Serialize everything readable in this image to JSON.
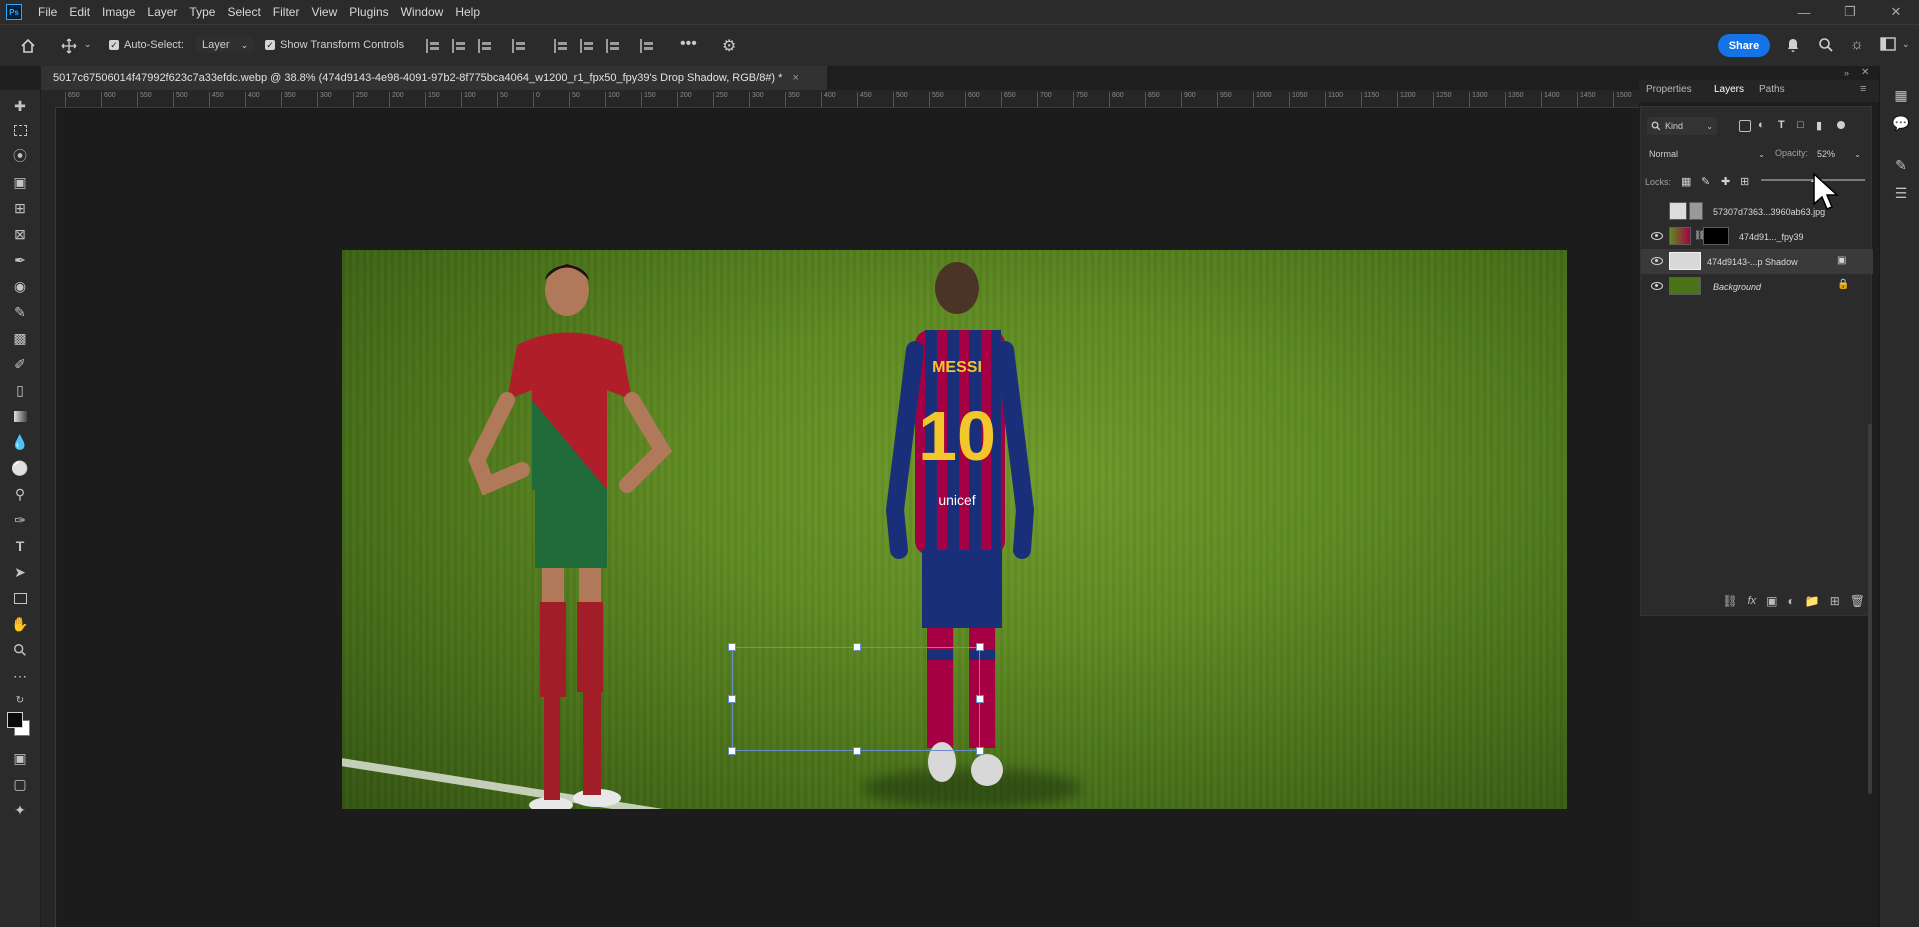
{
  "menubar": {
    "logo": "Ps",
    "items": [
      "File",
      "Edit",
      "Image",
      "Layer",
      "Type",
      "Select",
      "Filter",
      "View",
      "Plugins",
      "Window",
      "Help"
    ]
  },
  "options": {
    "auto_select_label": "Auto-Select:",
    "auto_select_target": "Layer",
    "transform_label": "Show Transform Controls",
    "share_label": "Share"
  },
  "document": {
    "tab_title": "5017c67506014f47992f623c7a33efdc.webp @ 38.8% (474d9143-4e98-4091-97b2-8f775bca4064_w1200_r1_fpx50_fpy39's Drop Shadow, RGB/8#) *",
    "close": "×"
  },
  "ruler": {
    "h_ticks": [
      "650",
      "600",
      "550",
      "500",
      "450",
      "400",
      "350",
      "300",
      "250",
      "200",
      "150",
      "100",
      "50",
      "0",
      "50",
      "100",
      "150",
      "200",
      "250",
      "300",
      "350",
      "400",
      "450",
      "500",
      "550",
      "600",
      "650",
      "700",
      "750",
      "800",
      "850",
      "900",
      "950",
      "1000",
      "1050",
      "1100",
      "1150",
      "1200",
      "1250",
      "1300",
      "1350",
      "1400",
      "1450",
      "1500"
    ]
  },
  "panel": {
    "tabs": [
      "Properties",
      "Layers",
      "Paths"
    ],
    "active_tab": "Layers",
    "filter_label": "Kind",
    "blend_mode": "Normal",
    "opacity_label": "Opacity:",
    "opacity_value": "52%",
    "locks_label": "Locks:",
    "layers": [
      {
        "name": "57307d7363...3960ab63.jpg",
        "visible": false,
        "selected": false
      },
      {
        "name": "474d91..._fpy39",
        "visible": true,
        "selected": false
      },
      {
        "name": "474d9143-...p Shadow",
        "visible": true,
        "selected": true
      },
      {
        "name": "Background",
        "visible": true,
        "selected": false,
        "locked": true
      }
    ]
  },
  "colors": {
    "accent": "#1473e6",
    "panel_bg": "#2b2b2b",
    "canvas_bg": "#1c1c1c",
    "selection": "#6a8cc8"
  }
}
